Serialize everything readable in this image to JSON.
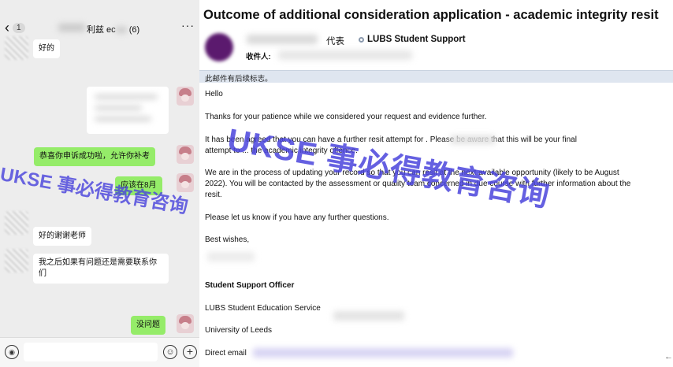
{
  "chat": {
    "back_badge": "1",
    "title": "利兹 ec",
    "member_count": "(6)",
    "more": "···",
    "messages": [
      {
        "side": "left",
        "text": "好的"
      },
      {
        "side": "right",
        "text": "恭喜你申诉成功啦，允许你补考"
      },
      {
        "side": "right",
        "text": "应该在8月"
      },
      {
        "side": "left",
        "text": "好的谢谢老师"
      },
      {
        "side": "left",
        "text": "我之后如果有问题还是需要联系你们"
      },
      {
        "side": "right",
        "text": "没问题"
      }
    ]
  },
  "email": {
    "subject": "Outcome of additional consideration application - academic integrity resit",
    "sender_label": "代表",
    "sender_name": "LUBS Student Support",
    "recipients_label": "收件人:",
    "followup_banner": "此邮件有后续标志。",
    "body": {
      "greeting": "Hello",
      "p1": "Thanks for your patience while we considered your request and evidence further.",
      "p2_line1": "It has been agreed that you can have a further resit attempt for            . Please be aware that this will be your final",
      "p2_line2": "attempt to ... the academic integrity offence.",
      "p3_line1": "We are in the process of updating your record so that you can resit at the next available opportunity (likely to be August",
      "p3_line2": "2022). You will be contacted by the assessment or quality team concerned in due course with further information about the",
      "p3_line3": "resit.",
      "p4": "Please let us know if you have any further questions.",
      "closing": "Best wishes,",
      "sig_title": "Student Support Officer",
      "sig_dept": "LUBS Student Education Service",
      "sig_univ": "University of Leeds",
      "sig_email_label": "Direct email"
    }
  },
  "watermark": {
    "text": "UKSE 事必得教育咨询",
    "color": "#4a44dc"
  }
}
